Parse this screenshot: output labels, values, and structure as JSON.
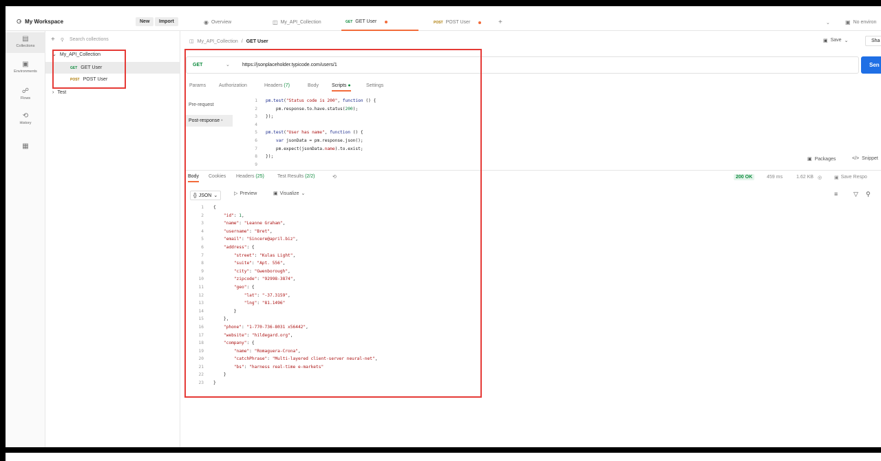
{
  "workspace": {
    "title": "My Workspace",
    "new_label": "New",
    "import_label": "Import"
  },
  "tabs": [
    {
      "label": "Overview"
    },
    {
      "label": "My_API_Collection"
    },
    {
      "method": "GET",
      "label": "GET User"
    },
    {
      "method": "POST",
      "label": "POST User"
    }
  ],
  "env": {
    "label": "No environ"
  },
  "rail": [
    {
      "label": "Collections"
    },
    {
      "label": "Environments"
    },
    {
      "label": "Flows"
    },
    {
      "label": "History"
    }
  ],
  "sidebar": {
    "search_placeholder": "Search collections",
    "collection": "My_API_Collection",
    "items": [
      {
        "method": "GET",
        "label": "GET User"
      },
      {
        "method": "POST",
        "label": "POST User"
      }
    ],
    "folder": "Test"
  },
  "breadcrumb": {
    "collection": "My_API_Collection",
    "sep": "/",
    "current": "GET User"
  },
  "toolbar": {
    "save_label": "Save",
    "share_label": "Sha"
  },
  "request": {
    "method": "GET",
    "url": "https://jsonplaceholder.typicode.com/users/1",
    "send_label": "Sen",
    "tabs": [
      "Params",
      "Authorization",
      "Headers",
      "Body",
      "Scripts",
      "Settings"
    ],
    "headers_count": "(7)",
    "scripts_side": [
      "Pre-request",
      "Post-response"
    ]
  },
  "script_lines": [
    "1",
    "2",
    "3",
    "4",
    "5",
    "6",
    "7",
    "8",
    "9"
  ],
  "tools": {
    "packages": "Packages",
    "snippets": "Snippet"
  },
  "response": {
    "tabs": [
      "Body",
      "Cookies",
      "Headers",
      "Test Results"
    ],
    "headers_count": "(25)",
    "tests_count": "(2/2)",
    "status": "200 OK",
    "time": "459 ms",
    "size": "1.62 KB",
    "save_label": "Save Respo",
    "format": "JSON",
    "preview": "Preview",
    "visualize": "Visualize"
  }
}
